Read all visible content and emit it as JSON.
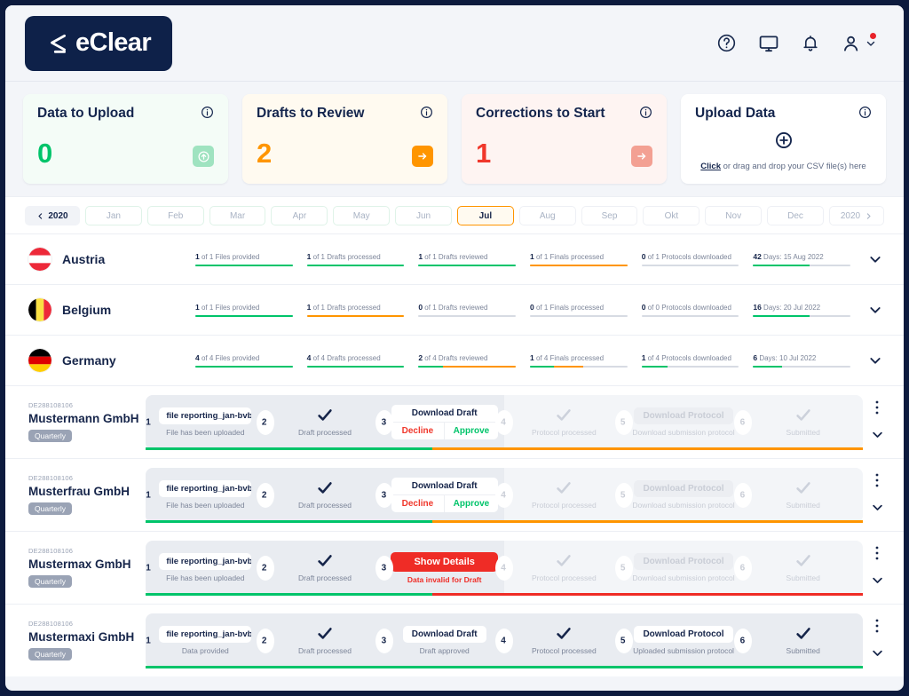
{
  "brand": {
    "name": "eClear",
    "navy": "#0e2149",
    "green": "#00c46a",
    "orange": "#ff9500",
    "red": "#f0372b"
  },
  "header": {
    "icons": [
      {
        "name": "help-circle-icon",
        "label": "Help"
      },
      {
        "name": "monitor-icon",
        "label": "Display"
      },
      {
        "name": "bell-icon",
        "label": "Notifications"
      },
      {
        "name": "user-account-icon",
        "label": "Account"
      }
    ]
  },
  "cards": [
    {
      "title": "Data to Upload",
      "value": "0",
      "tone": "green",
      "action_icon": "upload-circle-icon"
    },
    {
      "title": "Drafts to Review",
      "value": "2",
      "tone": "orange",
      "action_icon": "arrow-right-icon"
    },
    {
      "title": "Corrections to Start",
      "value": "1",
      "tone": "red",
      "action_icon": "arrow-right-icon"
    },
    {
      "title": "Upload Data",
      "tone": "white",
      "hint_link": "Click",
      "hint_rest": " or drag and drop your CSV file(s) here"
    }
  ],
  "month_selector": {
    "year_prev": "2020",
    "year_next": "2020",
    "active": "Jul",
    "months": [
      {
        "label": "Jan",
        "state": "past"
      },
      {
        "label": "Feb",
        "state": "past"
      },
      {
        "label": "Mar",
        "state": "past"
      },
      {
        "label": "Apr",
        "state": "past"
      },
      {
        "label": "May",
        "state": "past"
      },
      {
        "label": "Jun",
        "state": "past"
      },
      {
        "label": "Jul",
        "state": "active"
      },
      {
        "label": "Aug",
        "state": "future"
      },
      {
        "label": "Sep",
        "state": "future"
      },
      {
        "label": "Okt",
        "state": "future"
      },
      {
        "label": "Nov",
        "state": "future"
      },
      {
        "label": "Dec",
        "state": "future"
      }
    ]
  },
  "countries": [
    {
      "name": "Austria",
      "flag": "austria",
      "metrics": [
        {
          "count": "1",
          "of": "of 1",
          "label": "Files provided",
          "pct": 100,
          "color": "#00c46a"
        },
        {
          "count": "1",
          "of": "of 1",
          "label": "Drafts processed",
          "pct": 100,
          "color": "#00c46a"
        },
        {
          "count": "1",
          "of": "of 1",
          "label": "Drafts reviewed",
          "pct": 100,
          "color": "#00c46a"
        },
        {
          "count": "1",
          "of": "of 1",
          "label": "Finals processed",
          "pct": 100,
          "color": "#ff9500"
        },
        {
          "count": "0",
          "of": "of 1",
          "label": "Protocols downloaded",
          "pct": 0,
          "color": "#d7dbe3"
        },
        {
          "count": "42",
          "of": "Days:",
          "label": "15 Aug 2022",
          "pct": 58,
          "color": "#00c46a"
        }
      ]
    },
    {
      "name": "Belgium",
      "flag": "belgium",
      "metrics": [
        {
          "count": "1",
          "of": "of 1",
          "label": "Files provided",
          "pct": 100,
          "color": "#00c46a"
        },
        {
          "count": "1",
          "of": "of 1",
          "label": "Drafts processed",
          "pct": 100,
          "color": "#ff9500"
        },
        {
          "count": "0",
          "of": "of 1",
          "label": "Drafts reviewed",
          "pct": 0,
          "color": "#d7dbe3"
        },
        {
          "count": "0",
          "of": "of 1",
          "label": "Finals processed",
          "pct": 0,
          "color": "#d7dbe3"
        },
        {
          "count": "0",
          "of": "of 0",
          "label": "Protocols downloaded",
          "pct": 0,
          "color": "#d7dbe3"
        },
        {
          "count": "16",
          "of": "Days:",
          "label": "20 Jul 2022",
          "pct": 58,
          "color": "#00c46a"
        }
      ]
    },
    {
      "name": "Germany",
      "flag": "germany",
      "metrics": [
        {
          "count": "4",
          "of": "of 4",
          "label": "Files provided",
          "pct": 100,
          "color": "#00c46a"
        },
        {
          "count": "4",
          "of": "of 4",
          "label": "Drafts processed",
          "pct": 100,
          "color": "#00c46a"
        },
        {
          "count": "2",
          "of": "of 4",
          "label": "Drafts reviewed",
          "pct": 25,
          "pct2": 100,
          "color": "#00c46a",
          "color2": "#ff9500"
        },
        {
          "count": "1",
          "of": "of 4",
          "label": "Finals processed",
          "pct": 25,
          "pct2": 55,
          "color": "#00c46a",
          "color2": "#ff9500"
        },
        {
          "count": "1",
          "of": "of 4",
          "label": "Protocols downloaded",
          "pct": 27,
          "color": "#00c46a"
        },
        {
          "count": "6",
          "of": "Days:",
          "label": "10 Jul 2022",
          "pct": 30,
          "color": "#00c46a"
        }
      ]
    }
  ],
  "companies": [
    {
      "vat": "DE288108106",
      "name": "Mustermann GmbH",
      "badge": "Quarterly",
      "progress": [
        {
          "pct": 40,
          "color": "#00c46a"
        },
        {
          "pct": 60,
          "color": "#ff9500"
        }
      ],
      "stages": [
        {
          "num": "1",
          "type": "chip",
          "chip": "file reporting_jan-bvbbaa",
          "caption": "File has been uploaded",
          "dim": false
        },
        {
          "num": "2",
          "type": "check",
          "caption": "Draft processed",
          "dim": false
        },
        {
          "num": "3",
          "type": "dual",
          "dual_top": "Download Draft",
          "decline": "Decline",
          "approve": "Approve",
          "caption": "",
          "dim": false
        },
        {
          "num": "4",
          "type": "check",
          "caption": "Protocol processed",
          "dim": true
        },
        {
          "num": "5",
          "type": "ghost",
          "ghost": "Download Protocol",
          "caption": "Download submission protocol",
          "dim": true
        },
        {
          "num": "6",
          "type": "check",
          "caption": "Submitted",
          "dim": true
        }
      ]
    },
    {
      "vat": "DE288108106",
      "name": "Musterfrau GmbH",
      "badge": "Quarterly",
      "progress": [
        {
          "pct": 40,
          "color": "#00c46a"
        },
        {
          "pct": 60,
          "color": "#ff9500"
        }
      ],
      "stages": [
        {
          "num": "1",
          "type": "chip",
          "chip": "file reporting_jan-bvbbaa",
          "caption": "File has been uploaded",
          "dim": false
        },
        {
          "num": "2",
          "type": "check",
          "caption": "Draft processed",
          "dim": false
        },
        {
          "num": "3",
          "type": "dual",
          "dual_top": "Download Draft",
          "decline": "Decline",
          "approve": "Approve",
          "caption": "",
          "dim": false
        },
        {
          "num": "4",
          "type": "check",
          "caption": "Protocol processed",
          "dim": true
        },
        {
          "num": "5",
          "type": "ghost",
          "ghost": "Download Protocol",
          "caption": "Download submission protocol",
          "dim": true
        },
        {
          "num": "6",
          "type": "check",
          "caption": "Submitted",
          "dim": true
        }
      ]
    },
    {
      "vat": "DE288108106",
      "name": "Mustermax GmbH",
      "badge": "Quarterly",
      "progress": [
        {
          "pct": 40,
          "color": "#00c46a"
        },
        {
          "pct": 60,
          "color": "#ef2c26"
        }
      ],
      "stages": [
        {
          "num": "1",
          "type": "chip",
          "chip": "file reporting_jan-bvbbaa",
          "caption": "File has been uploaded",
          "dim": false
        },
        {
          "num": "2",
          "type": "check",
          "caption": "Draft processed",
          "dim": false
        },
        {
          "num": "3",
          "type": "danger",
          "danger": "Show Details",
          "caption": "Data invalid for Draft",
          "dim": false
        },
        {
          "num": "4",
          "type": "check",
          "caption": "Protocol processed",
          "dim": true
        },
        {
          "num": "5",
          "type": "ghost",
          "ghost": "Download Protocol",
          "caption": "Download submission protocol",
          "dim": true
        },
        {
          "num": "6",
          "type": "check",
          "caption": "Submitted",
          "dim": true
        }
      ]
    },
    {
      "vat": "DE288108106",
      "name": "Mustermaxi GmbH",
      "badge": "Quarterly",
      "progress": [
        {
          "pct": 100,
          "color": "#00c46a"
        }
      ],
      "stages": [
        {
          "num": "1",
          "type": "chip",
          "chip": "file reporting_jan-bvbbaa",
          "caption": "Data provided",
          "dim": false
        },
        {
          "num": "2",
          "type": "check",
          "caption": "Draft processed",
          "dim": false
        },
        {
          "num": "3",
          "type": "button",
          "button": "Download Draft",
          "caption": "Draft approved",
          "dim": false
        },
        {
          "num": "4",
          "type": "check",
          "caption": "Protocol processed",
          "dim": false
        },
        {
          "num": "5",
          "type": "button",
          "button": "Download Protocol",
          "caption": "Uploaded submission protocol",
          "dim": false
        },
        {
          "num": "6",
          "type": "check",
          "caption": "Submitted",
          "dim": false
        }
      ]
    }
  ]
}
